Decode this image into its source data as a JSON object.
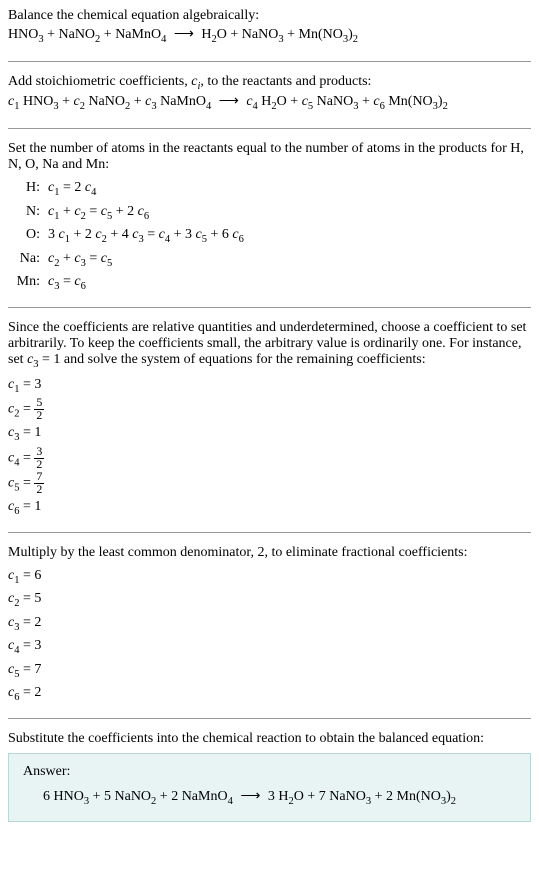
{
  "section1": {
    "title": "Balance the chemical equation algebraically:",
    "equation_html": "HNO<sub>3</sub> + NaNO<sub>2</sub> + NaMnO<sub>4</sub> <span class='arrow'>⟶</span> H<sub>2</sub>O + NaNO<sub>3</sub> + Mn(NO<sub>3</sub>)<sub>2</sub>"
  },
  "section2": {
    "title_html": "Add stoichiometric coefficients, <span class='italic-c'>c<sub>i</sub></span>, to the reactants and products:",
    "equation_html": "<span class='italic-c'>c</span><sub>1</sub> HNO<sub>3</sub> + <span class='italic-c'>c</span><sub>2</sub> NaNO<sub>2</sub> + <span class='italic-c'>c</span><sub>3</sub> NaMnO<sub>4</sub> <span class='arrow'>⟶</span> <span class='italic-c'>c</span><sub>4</sub> H<sub>2</sub>O + <span class='italic-c'>c</span><sub>5</sub> NaNO<sub>3</sub> + <span class='italic-c'>c</span><sub>6</sub> Mn(NO<sub>3</sub>)<sub>2</sub>"
  },
  "section3": {
    "title": "Set the number of atoms in the reactants equal to the number of atoms in the products for H, N, O, Na and Mn:",
    "atoms": [
      {
        "label": "H:",
        "eq_html": "<span class='italic-c'>c</span><sub>1</sub> = 2 <span class='italic-c'>c</span><sub>4</sub>"
      },
      {
        "label": "N:",
        "eq_html": "<span class='italic-c'>c</span><sub>1</sub> + <span class='italic-c'>c</span><sub>2</sub> = <span class='italic-c'>c</span><sub>5</sub> + 2 <span class='italic-c'>c</span><sub>6</sub>"
      },
      {
        "label": "O:",
        "eq_html": "3 <span class='italic-c'>c</span><sub>1</sub> + 2 <span class='italic-c'>c</span><sub>2</sub> + 4 <span class='italic-c'>c</span><sub>3</sub> = <span class='italic-c'>c</span><sub>4</sub> + 3 <span class='italic-c'>c</span><sub>5</sub> + 6 <span class='italic-c'>c</span><sub>6</sub>"
      },
      {
        "label": "Na:",
        "eq_html": "<span class='italic-c'>c</span><sub>2</sub> + <span class='italic-c'>c</span><sub>3</sub> = <span class='italic-c'>c</span><sub>5</sub>"
      },
      {
        "label": "Mn:",
        "eq_html": "<span class='italic-c'>c</span><sub>3</sub> = <span class='italic-c'>c</span><sub>6</sub>"
      }
    ]
  },
  "section4": {
    "title_html": "Since the coefficients are relative quantities and underdetermined, choose a coefficient to set arbitrarily. To keep the coefficients small, the arbitrary value is ordinarily one. For instance, set <span class='italic-c'>c</span><sub>3</sub> = 1 and solve the system of equations for the remaining coefficients:",
    "coeffs": [
      {
        "html": "<span class='italic-c'>c</span><sub>1</sub> = 3"
      },
      {
        "html": "<span class='italic-c'>c</span><sub>2</sub> = <span class='frac'><span class='num'>5</span><span class='den'>2</span></span>"
      },
      {
        "html": "<span class='italic-c'>c</span><sub>3</sub> = 1"
      },
      {
        "html": "<span class='italic-c'>c</span><sub>4</sub> = <span class='frac'><span class='num'>3</span><span class='den'>2</span></span>"
      },
      {
        "html": "<span class='italic-c'>c</span><sub>5</sub> = <span class='frac'><span class='num'>7</span><span class='den'>2</span></span>"
      },
      {
        "html": "<span class='italic-c'>c</span><sub>6</sub> = 1"
      }
    ]
  },
  "section5": {
    "title": "Multiply by the least common denominator, 2, to eliminate fractional coefficients:",
    "coeffs": [
      {
        "html": "<span class='italic-c'>c</span><sub>1</sub> = 6"
      },
      {
        "html": "<span class='italic-c'>c</span><sub>2</sub> = 5"
      },
      {
        "html": "<span class='italic-c'>c</span><sub>3</sub> = 2"
      },
      {
        "html": "<span class='italic-c'>c</span><sub>4</sub> = 3"
      },
      {
        "html": "<span class='italic-c'>c</span><sub>5</sub> = 7"
      },
      {
        "html": "<span class='italic-c'>c</span><sub>6</sub> = 2"
      }
    ]
  },
  "section6": {
    "title": "Substitute the coefficients into the chemical reaction to obtain the balanced equation:",
    "answer_label": "Answer:",
    "answer_html": "6 HNO<sub>3</sub> + 5 NaNO<sub>2</sub> + 2 NaMnO<sub>4</sub> <span class='arrow'>⟶</span> 3 H<sub>2</sub>O + 7 NaNO<sub>3</sub> + 2 Mn(NO<sub>3</sub>)<sub>2</sub>"
  }
}
